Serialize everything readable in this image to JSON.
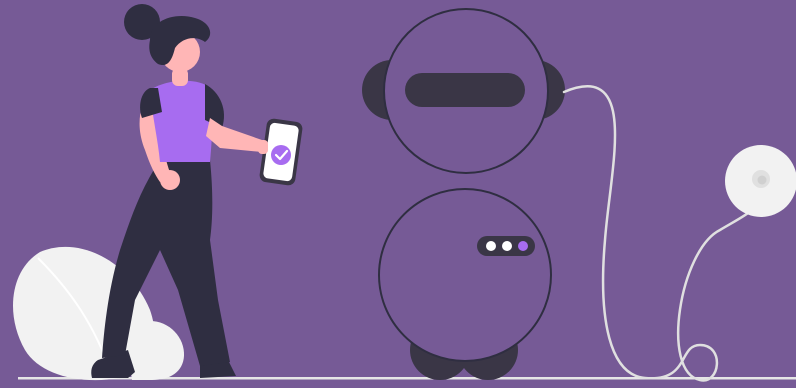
{
  "scene": {
    "description_icons": [
      "person-icon",
      "smartphone-icon",
      "checkmark-icon",
      "robot-icon",
      "power-plug-icon",
      "plant-leaf-icon"
    ],
    "colors": {
      "background": "#765A96",
      "robot_fill": "#765A96",
      "dark": "#3A3646",
      "outline": "#2F2E41",
      "accent_purple": "#A76CF0",
      "light_gray": "#F2F2F2",
      "cable": "#E0E0E0",
      "skin": "#FFB6B6",
      "white": "#FFFFFF"
    },
    "indicator_lights": [
      {
        "state": "off",
        "color": "#FFFFFF"
      },
      {
        "state": "off",
        "color": "#FFFFFF"
      },
      {
        "state": "on",
        "color": "#A76CF0"
      }
    ]
  }
}
